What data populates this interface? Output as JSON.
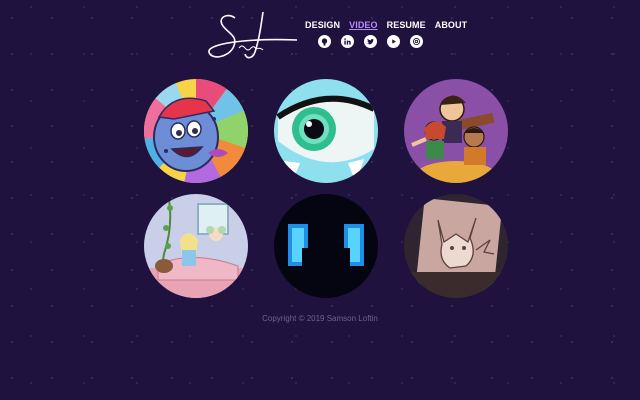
{
  "nav": {
    "items": [
      {
        "label": "DESIGN"
      },
      {
        "label": "VIDEO",
        "active": true
      },
      {
        "label": "RESUME"
      },
      {
        "label": "ABOUT"
      }
    ]
  },
  "social": {
    "icons": [
      "github-icon",
      "linkedin-icon",
      "twitter-icon",
      "youtube-icon",
      "dribbble-icon"
    ]
  },
  "gallery": {
    "items": [
      {
        "name": "video-thumb-colorful-character"
      },
      {
        "name": "video-thumb-eye"
      },
      {
        "name": "video-thumb-group-characters"
      },
      {
        "name": "video-thumb-bedroom-scene"
      },
      {
        "name": "video-thumb-dark-windows"
      },
      {
        "name": "video-thumb-pikachu-drawing"
      }
    ]
  },
  "footer": {
    "copyright": "Copyright © 2019 Samson Loftin"
  },
  "colors": {
    "background": "#20123f",
    "accent": "#b88aff",
    "nav_text": "#ffffff",
    "footer_text": "#6c628d"
  }
}
